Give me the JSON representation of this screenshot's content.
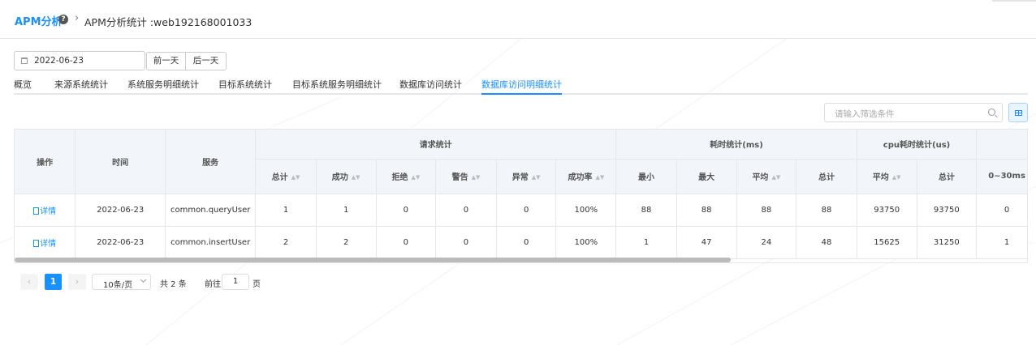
{
  "breadcrumb": {
    "root": "APM分析",
    "help_icon": "?",
    "separator": "›",
    "current": "APM分析统计 :web192168001033"
  },
  "date_filter": {
    "value": "2022-06-23",
    "calendar_icon": "calendar-icon",
    "prev_label": "前一天",
    "next_label": "后一天"
  },
  "tabs": [
    {
      "label": "概览",
      "active": false
    },
    {
      "label": "来源系统统计",
      "active": false
    },
    {
      "label": "系统服务明细统计",
      "active": false
    },
    {
      "label": "目标系统统计",
      "active": false
    },
    {
      "label": "目标系统服务明细统计",
      "active": false
    },
    {
      "label": "数据库访问统计",
      "active": false
    },
    {
      "label": "数据库访问明细统计",
      "active": true
    }
  ],
  "search": {
    "placeholder": "请输入筛选条件",
    "icon": "search-icon"
  },
  "view_toggle_icon": "grid-icon",
  "table": {
    "groups": {
      "op": "操作",
      "time": "时间",
      "service": "服务",
      "requests": "请求统计",
      "duration": "耗时统计(ms)",
      "cpu": "cpu耗时统计(us)"
    },
    "columns": [
      "总计",
      "成功",
      "拒绝",
      "警告",
      "异常",
      "成功率",
      "最小",
      "最大",
      "平均",
      "总计",
      "平均",
      "总计",
      "0~30ms"
    ],
    "sort_marker": "▲▼",
    "detail_label": "详情",
    "rows": [
      {
        "time": "2022-06-23",
        "service": "common.queryUser",
        "total": "1",
        "success": "1",
        "rejected": "0",
        "warning": "0",
        "error": "0",
        "success_rate": "100%",
        "min": "88",
        "max": "88",
        "avg": "88",
        "dur_total": "88",
        "cpu_avg": "93750",
        "cpu_total": "93750",
        "range_0_30": "0"
      },
      {
        "time": "2022-06-23",
        "service": "common.insertUser",
        "total": "2",
        "success": "2",
        "rejected": "0",
        "warning": "0",
        "error": "0",
        "success_rate": "100%",
        "min": "1",
        "max": "47",
        "avg": "24",
        "dur_total": "48",
        "cpu_avg": "15625",
        "cpu_total": "31250",
        "range_0_30": "1"
      }
    ]
  },
  "pagination": {
    "prev": "‹",
    "current_page": "1",
    "next": "›",
    "page_size": "10条/页",
    "total": "共 2 条",
    "goto_label": "前往",
    "goto_value": "1",
    "goto_suffix": "页"
  }
}
